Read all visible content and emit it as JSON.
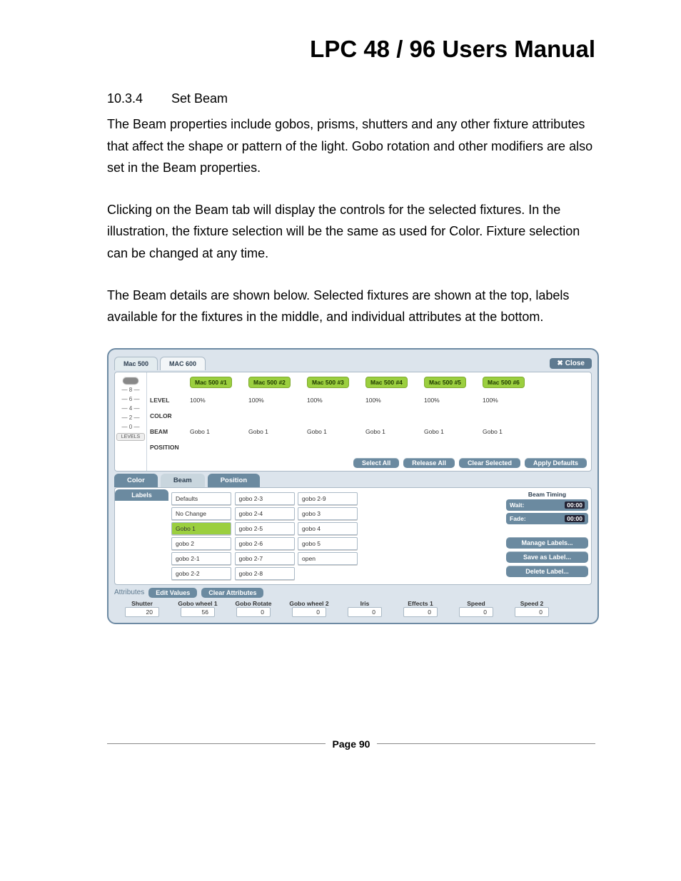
{
  "doc_title": "LPC 48 / 96 Users Manual",
  "section_number": "10.3.4",
  "section_title": "Set Beam",
  "para1": "The Beam properties include gobos, prisms, shutters and any other fixture attributes that affect the shape or pattern of the light. Gobo rotation and other modifiers are also set in the Beam properties.",
  "para2": "Clicking on the Beam tab will display the controls for the selected fixtures.  In the illustration, the fixture selection will be the same as used for Color.  Fixture selection can be changed at any time.",
  "para3": "The  Beam details are shown below.  Selected fixtures are shown at the top, labels available for the fixtures in the middle, and individual attributes at the bottom.",
  "page_label": "Page 90",
  "device_tabs": {
    "a": "Mac 500",
    "b": "MAC 600"
  },
  "close_label": "Close",
  "level_ticks": {
    "t8": "— 8 —",
    "t6": "— 6 —",
    "t4": "— 4 —",
    "t2": "— 2 —",
    "t0": "— 0 —"
  },
  "level_btn": "LEVELS",
  "fixtures": {
    "h1": "Mac 500 #1",
    "h2": "Mac 500 #2",
    "h3": "Mac 500 #3",
    "h4": "Mac 500 #4",
    "h5": "Mac 500 #5",
    "h6": "Mac 500 #6"
  },
  "row_labels": {
    "level": "LEVEL",
    "color": "COLOR",
    "beam": "BEAM",
    "position": "POSITION"
  },
  "level_vals": {
    "v1": "100%",
    "v2": "100%",
    "v3": "100%",
    "v4": "100%",
    "v5": "100%",
    "v6": "100%"
  },
  "beam_vals": {
    "v1": "Gobo 1",
    "v2": "Gobo 1",
    "v3": "Gobo 1",
    "v4": "Gobo 1",
    "v5": "Gobo 1",
    "v6": "Gobo 1"
  },
  "buttons": {
    "select_all": "Select All",
    "release_all": "Release All",
    "clear_selected": "Clear Selected",
    "apply_defaults": "Apply Defaults"
  },
  "mid_tabs": {
    "color": "Color",
    "beam": "Beam",
    "position": "Position"
  },
  "labels_tab": "Labels",
  "label_cols": {
    "c0": {
      "r0": "Defaults",
      "r1": "No Change",
      "r2": "Gobo 1",
      "r3": "gobo 2",
      "r4": "gobo 2-1",
      "r5": "gobo 2-2"
    },
    "c1": {
      "r0": "gobo 2-3",
      "r1": "gobo 2-4",
      "r2": "gobo 2-5",
      "r3": "gobo 2-6",
      "r4": "gobo 2-7",
      "r5": "gobo 2-8"
    },
    "c2": {
      "r0": "gobo 2-9",
      "r1": "gobo 3",
      "r2": "gobo 4",
      "r3": "gobo 5",
      "r4": "open"
    }
  },
  "timing": {
    "title": "Beam Timing",
    "wait_lab": "Wait:",
    "wait_val": "00:00",
    "fade_lab": "Fade:",
    "fade_val": "00:00",
    "manage": "Manage Labels...",
    "save": "Save as Label...",
    "delete": "Delete Label..."
  },
  "attr": {
    "title": "Attributes",
    "edit": "Edit Values",
    "clear": "Clear Attributes",
    "cols": {
      "shutter": {
        "lab": "Shutter",
        "v": "20"
      },
      "gw1": {
        "lab": "Gobo wheel 1",
        "v": "56"
      },
      "gr": {
        "lab": "Gobo Rotate",
        "v": "0"
      },
      "gw2": {
        "lab": "Gobo wheel 2",
        "v": "0"
      },
      "iris": {
        "lab": "Iris",
        "v": "0"
      },
      "eff1": {
        "lab": "Effects 1",
        "v": "0"
      },
      "spd": {
        "lab": "Speed",
        "v": "0"
      },
      "spd2": {
        "lab": "Speed 2",
        "v": "0"
      }
    }
  }
}
